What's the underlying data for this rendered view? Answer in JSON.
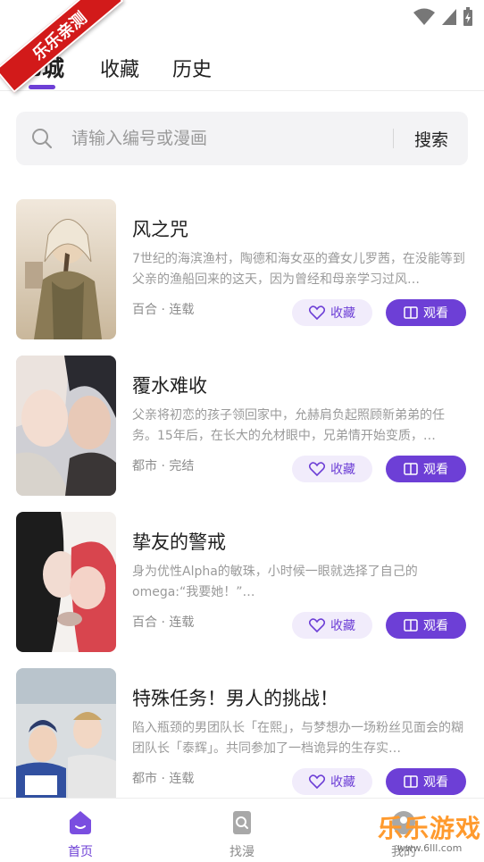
{
  "ribbon_text": "乐乐亲测",
  "tabs": [
    {
      "label": "书城",
      "active": true
    },
    {
      "label": "收藏",
      "active": false
    },
    {
      "label": "历史",
      "active": false
    }
  ],
  "search": {
    "placeholder": "请输入编号或漫画",
    "button_label": "搜索"
  },
  "comics": [
    {
      "title": "风之咒",
      "desc": "7世纪的海滨渔村，陶德和海女巫的聋女儿罗茜，在没能等到父亲的渔船回来的这天，因为曾经和母亲学习过风…",
      "meta": "百合 · 连载",
      "fav_label": "收藏",
      "read_label": "观看"
    },
    {
      "title": "覆水难收",
      "desc": "父亲将初恋的孩子领回家中，允赫肩负起照顾新弟弟的任务。15年后，在长大的允材眼中，兄弟情开始变质，…",
      "meta": "都市 · 完结",
      "fav_label": "收藏",
      "read_label": "观看"
    },
    {
      "title": "挚友的警戒",
      "desc": "身为优性Alpha的敏珠，小时候一眼就选择了自己的omega:“我要她！”…",
      "meta": "百合 · 连载",
      "fav_label": "收藏",
      "read_label": "观看"
    },
    {
      "title": "特殊任务！男人的挑战！",
      "desc": "陷入瓶颈的男团队长「在熙」，与梦想办一场粉丝见面会的糊团队长「泰辉」。共同参加了一档诡异的生存实…",
      "meta": "都市 · 连载",
      "fav_label": "收藏",
      "read_label": "观看"
    }
  ],
  "bottom_nav": [
    {
      "label": "首页",
      "active": true
    },
    {
      "label": "找漫",
      "active": false
    },
    {
      "label": "我的",
      "active": false
    }
  ],
  "watermark": {
    "text": "乐乐游戏",
    "sub": "www.6lll.com"
  },
  "colors": {
    "accent": "#6d3fd6",
    "ribbon": "#d21a1a",
    "watermark": "#ff9a2e"
  }
}
